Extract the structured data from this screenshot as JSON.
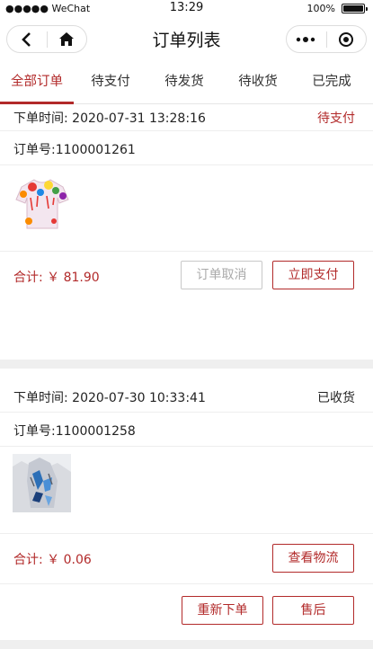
{
  "status_bar": {
    "carrier": "●●●●● WeChat",
    "time": "13:29",
    "battery": "100%"
  },
  "nav": {
    "title": "订单列表"
  },
  "tabs": [
    {
      "label": "全部订单"
    },
    {
      "label": "待支付"
    },
    {
      "label": "待发货"
    },
    {
      "label": "待收货"
    },
    {
      "label": "已完成"
    }
  ],
  "active_tab": "全部订单",
  "orders": [
    {
      "time_label": "下单时间:",
      "time": "2020-07-31 13:28:16",
      "status": "待支付",
      "status_color": "#b22a2a",
      "order_no": "订单号:1100001261",
      "total": "合计: ￥ 81.90",
      "buttons": [
        "订单取消",
        "立即支付"
      ],
      "product_image": "colorful-paint-splash-tshirt"
    },
    {
      "time_label": "下单时间:",
      "time": "2020-07-30 10:33:41",
      "status": "已收货",
      "status_color": "#222222",
      "order_no": "订单号:1100001258",
      "total": "合计: ￥ 0.06",
      "buttons": [
        "查看物流",
        "重新下单",
        "售后"
      ],
      "product_image": "blue-butterfly-print-shirt"
    }
  ],
  "colors": {
    "accent": "#b22a2a",
    "background": "#efefef"
  }
}
